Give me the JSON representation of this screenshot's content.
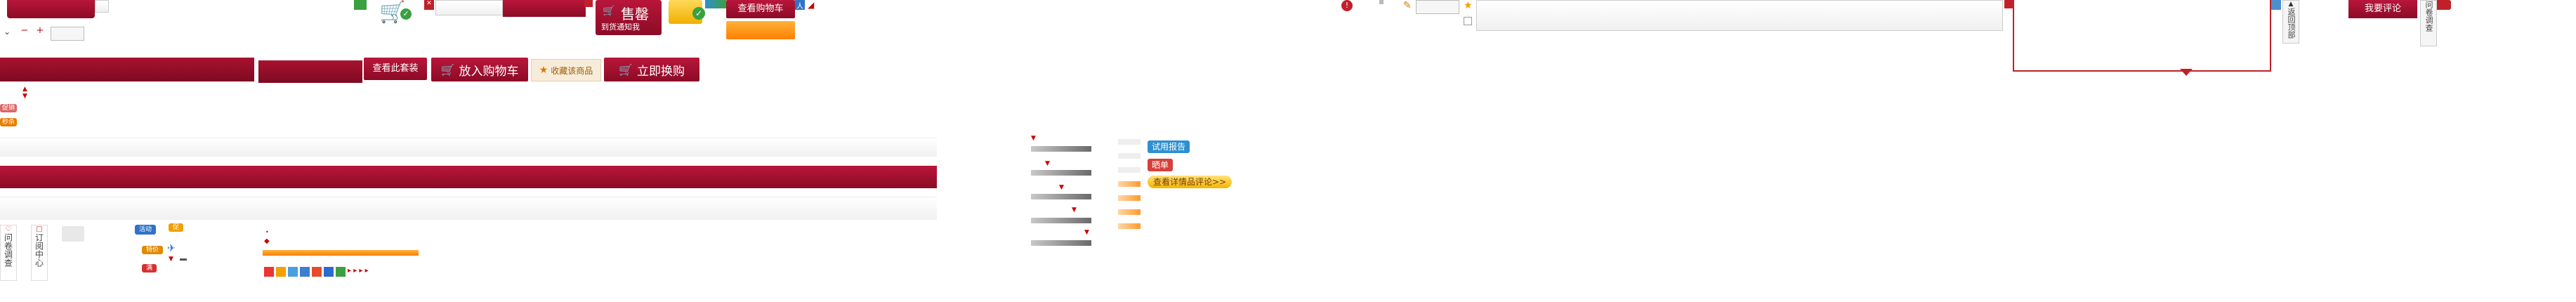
{
  "top_row": {
    "sell_notice_title": "售罄",
    "sell_notice_sub": "到货通知我",
    "view_cart": "查看购物车",
    "write_review": "我要评论"
  },
  "buttons_row": {
    "view_package": "查看此套装",
    "add_to_cart": "放入购物车",
    "favorite": "收藏该商品",
    "buy_now": "立即换购"
  },
  "tags": {
    "trial_report": "试用报告",
    "showcase": "晒单",
    "view_more_reviews": "查看详情品评论>>",
    "promo_small": "促销",
    "sale_badge": "秒杀",
    "sale_badge2": "特价"
  },
  "side_labels": {
    "questionnaire": "问卷调查",
    "order_center": "订阅中心",
    "feedback": "问卷调查",
    "back_top": "返回顶部"
  },
  "colors": {
    "brand_red": "#9e1030",
    "orange": "#ff8a00",
    "blue": "#2f8fd0"
  }
}
